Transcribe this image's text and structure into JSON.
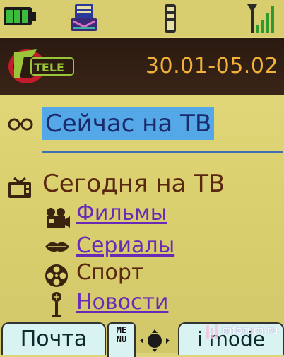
{
  "status_bar": {
    "battery_icon": "battery-icon",
    "mail_icon": "mail-icon",
    "imode_icon": "imode-indicator-icon",
    "signal_icon": "signal-strength-icon",
    "accent": "#2f9b2f"
  },
  "header": {
    "logo_text": "TELE",
    "date_range": "30.01-05.02"
  },
  "menu": {
    "now_on_tv": "Сейчас на ТВ",
    "today_on_tv": "Сегодня на ТВ",
    "items": [
      {
        "label": "Фильмы",
        "icon": "film-camera-icon"
      },
      {
        "label": "Сериалы",
        "icon": "lips-icon"
      },
      {
        "label": "Спорт",
        "icon": "film-reel-icon"
      },
      {
        "label": "Новости",
        "icon": "microphone-icon"
      }
    ]
  },
  "softkeys": {
    "left": "Почта",
    "menu": "ME\nNU",
    "right": "i mode"
  },
  "watermark": "mforum.ru",
  "colors": {
    "background": "#dcd37a",
    "highlight": "#54a8e8",
    "link": "#6a2ab8",
    "text": "#5a2810",
    "date": "#f2b23a"
  }
}
